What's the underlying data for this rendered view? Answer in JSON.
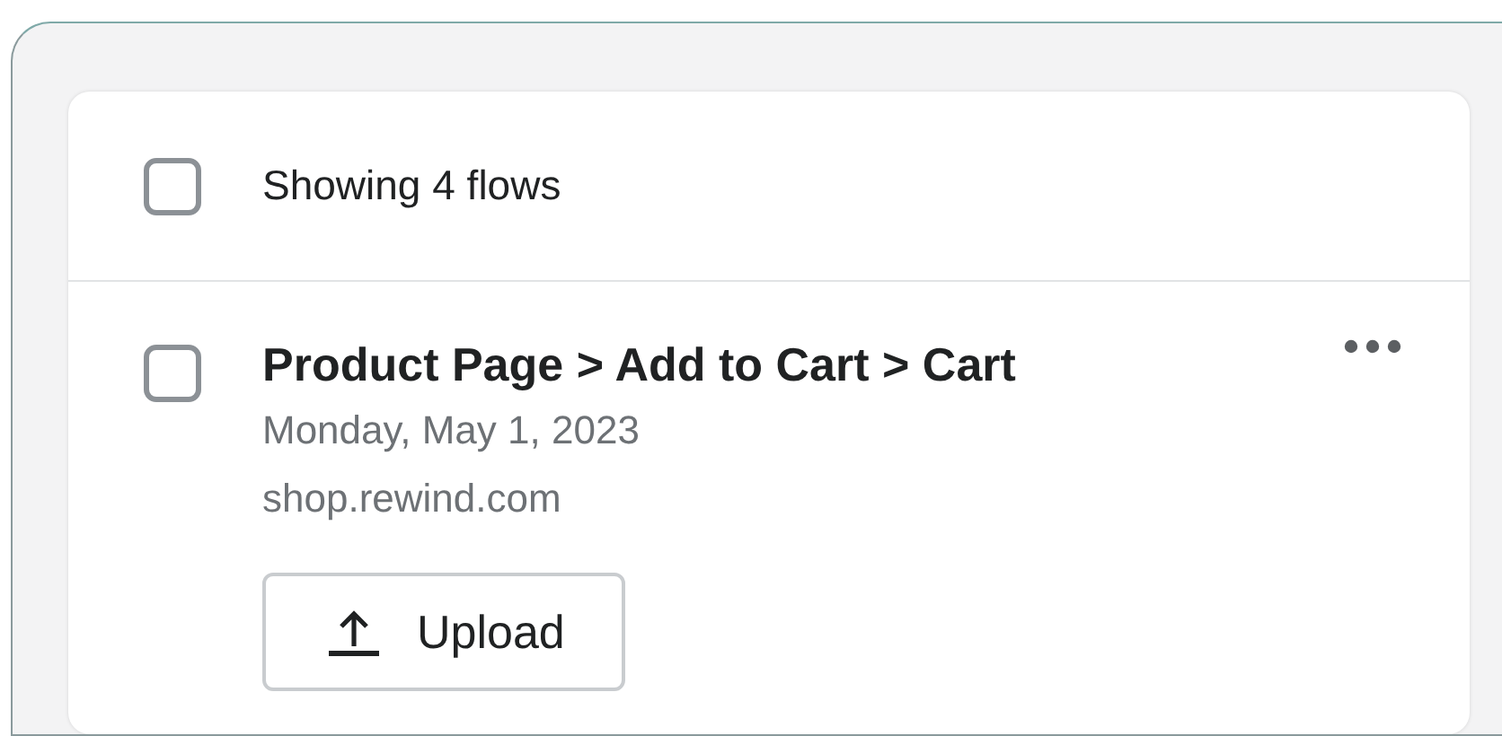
{
  "header": {
    "label": "Showing 4 flows",
    "checked": false
  },
  "flows": [
    {
      "title": "Product Page > Add to Cart > Cart",
      "date": "Monday, May 1, 2023",
      "domain": "shop.rewind.com",
      "checked": false,
      "button": "Upload"
    }
  ]
}
